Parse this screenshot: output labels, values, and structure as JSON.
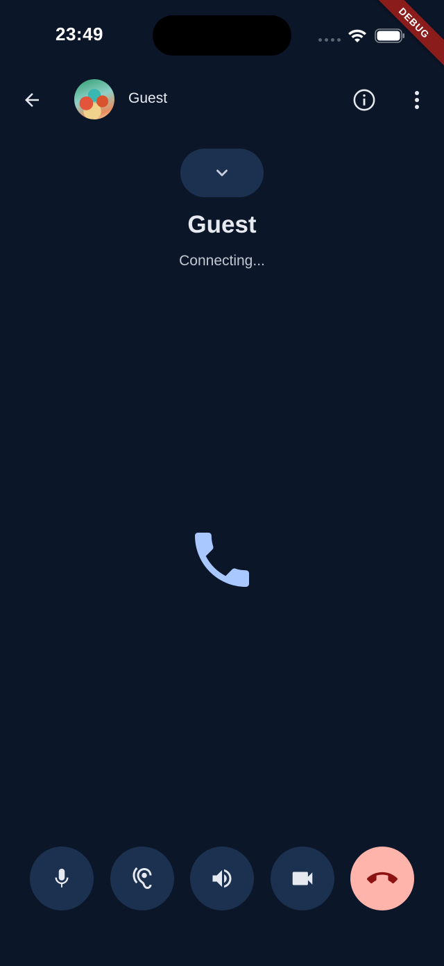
{
  "status_bar": {
    "time": "23:49"
  },
  "debug_banner": "DEBUG",
  "app_bar": {
    "contact_name": "Guest"
  },
  "call": {
    "title": "Guest",
    "status": "Connecting..."
  },
  "controls": [
    {
      "name": "microphone",
      "icon": "mic-icon"
    },
    {
      "name": "earpiece",
      "icon": "ear-icon"
    },
    {
      "name": "speaker",
      "icon": "volume-icon"
    },
    {
      "name": "video",
      "icon": "videocam-icon"
    },
    {
      "name": "end-call",
      "icon": "call-end-icon"
    }
  ],
  "colors": {
    "background": "#0b1628",
    "button": "#1c3150",
    "accent_phone": "#a8c8ff",
    "end_call_bg": "#ffb4ab",
    "end_call_icon": "#8c1212",
    "debug_ribbon": "#8b1c1c"
  }
}
